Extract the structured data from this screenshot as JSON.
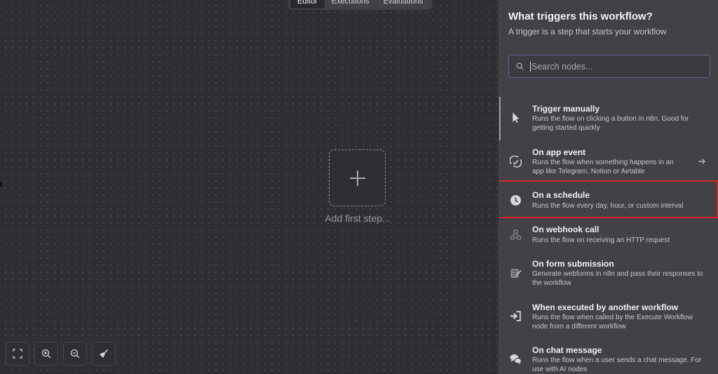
{
  "canvas": {
    "tabs": [
      {
        "label": "Editor",
        "active": true
      },
      {
        "label": "Executions",
        "active": false
      },
      {
        "label": "Evaluations",
        "active": false
      }
    ],
    "add_step_label": "Add first step...",
    "zoom_controls": [
      {
        "name": "fit-view-button",
        "icon": "fullscreen-icon"
      },
      {
        "name": "zoom-in-button",
        "icon": "zoom-in-icon"
      },
      {
        "name": "zoom-out-button",
        "icon": "zoom-out-icon"
      },
      {
        "name": "tidy-up-button",
        "icon": "broom-icon"
      }
    ]
  },
  "panel": {
    "title": "What triggers this workflow?",
    "subtitle": "A trigger is a step that starts your workflow",
    "search": {
      "placeholder": "Search nodes...",
      "value": ""
    },
    "items": [
      {
        "icon": "pointer-icon",
        "title": "Trigger manually",
        "desc": "Runs the flow on clicking a button in n8n. Good for getting started quickly"
      },
      {
        "icon": "app-event-icon",
        "title": "On app event",
        "desc": "Runs the flow when something happens in an app like Telegram, Notion or Airtable",
        "has_arrow": true
      },
      {
        "icon": "clock-icon",
        "title": "On a schedule",
        "desc": "Runs the flow every day, hour, or custom interval",
        "highlighted": true
      },
      {
        "icon": "webhook-icon",
        "title": "On webhook call",
        "desc": "Runs the flow on receiving an HTTP request"
      },
      {
        "icon": "form-icon",
        "title": "On form submission",
        "desc": "Generate webforms in n8n and pass their responses to the workflow"
      },
      {
        "icon": "sign-in-icon",
        "title": "When executed by another workflow",
        "desc": "Runs the flow when called by the Execute Workflow node from a different workflow"
      },
      {
        "icon": "chat-icon",
        "title": "On chat message",
        "desc": "Runs the flow when a user sends a chat message. For use with AI nodes"
      }
    ]
  },
  "colors": {
    "highlight": "#d6262b",
    "panel": "#414146",
    "canvas": "#2e2e33"
  }
}
